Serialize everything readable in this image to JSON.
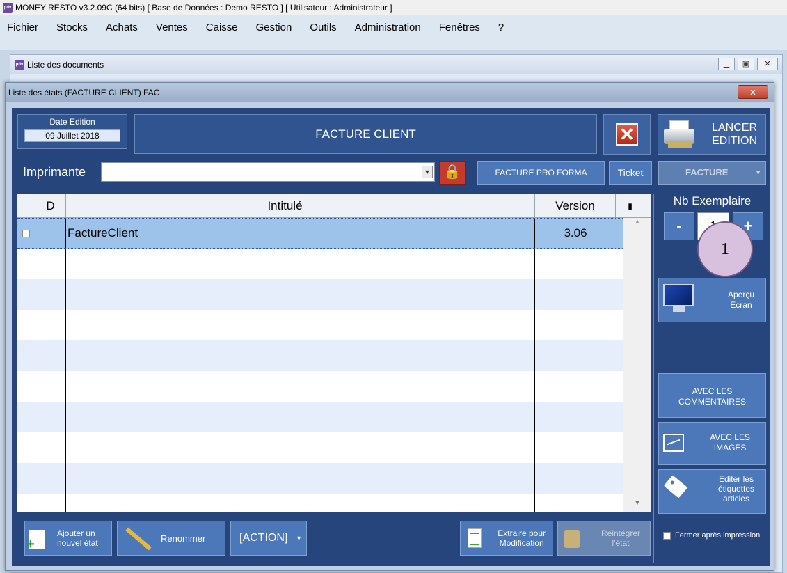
{
  "app": {
    "title": "MONEY RESTO v3.2.09C (64 bits) [ Base de Données : Demo RESTO ] [ Utilisateur : Administrateur ]",
    "logo_text": "pdv"
  },
  "menu": [
    "Fichier",
    "Stocks",
    "Achats",
    "Ventes",
    "Caisse",
    "Gestion",
    "Outils",
    "Administration",
    "Fenêtres",
    "?"
  ],
  "doc_window": {
    "title": "Liste des documents"
  },
  "dialog": {
    "title": "Liste des états (FACTURE CLIENT) FAC",
    "close_label": "x"
  },
  "header": {
    "date_label": "Date Edition",
    "date_value": "09 Juillet 2018",
    "report_title": "FACTURE CLIENT",
    "launch_label_1": "LANCER",
    "launch_label_2": "EDITION"
  },
  "printer": {
    "label": "Imprimante",
    "value": "",
    "proforma_label": "FACTURE PRO FORMA",
    "ticket_label": "Ticket",
    "type_label": "FACTURE"
  },
  "table": {
    "headers": [
      "",
      "D",
      "Intitulé",
      "",
      "Version"
    ],
    "rows": [
      {
        "checked": false,
        "d": "",
        "name": "FactureClient",
        "extra": "",
        "version": "3.06"
      }
    ]
  },
  "side": {
    "nb_label": "Nb Exemplaire",
    "minus": "-",
    "plus": "+",
    "qty": "1",
    "badge": "1",
    "apercu_1": "Aperçu",
    "apercu_2": "Ecran",
    "comments_1": "AVEC LES",
    "comments_2": "COMMENTAIRES",
    "images_1": "AVEC LES",
    "images_2": "IMAGES",
    "etiq_1": "Editer les",
    "etiq_2": "étiquettes",
    "etiq_3": "articles"
  },
  "bottom": {
    "add_1": "Ajouter un",
    "add_2": "nouvel état",
    "rename": "Renommer",
    "action": "[ACTION]",
    "extract_1": "Extraire pour",
    "extract_2": "Modification",
    "reint_1": "Réintégrer",
    "reint_2": "l'état",
    "close_after": "Fermer après impression"
  }
}
